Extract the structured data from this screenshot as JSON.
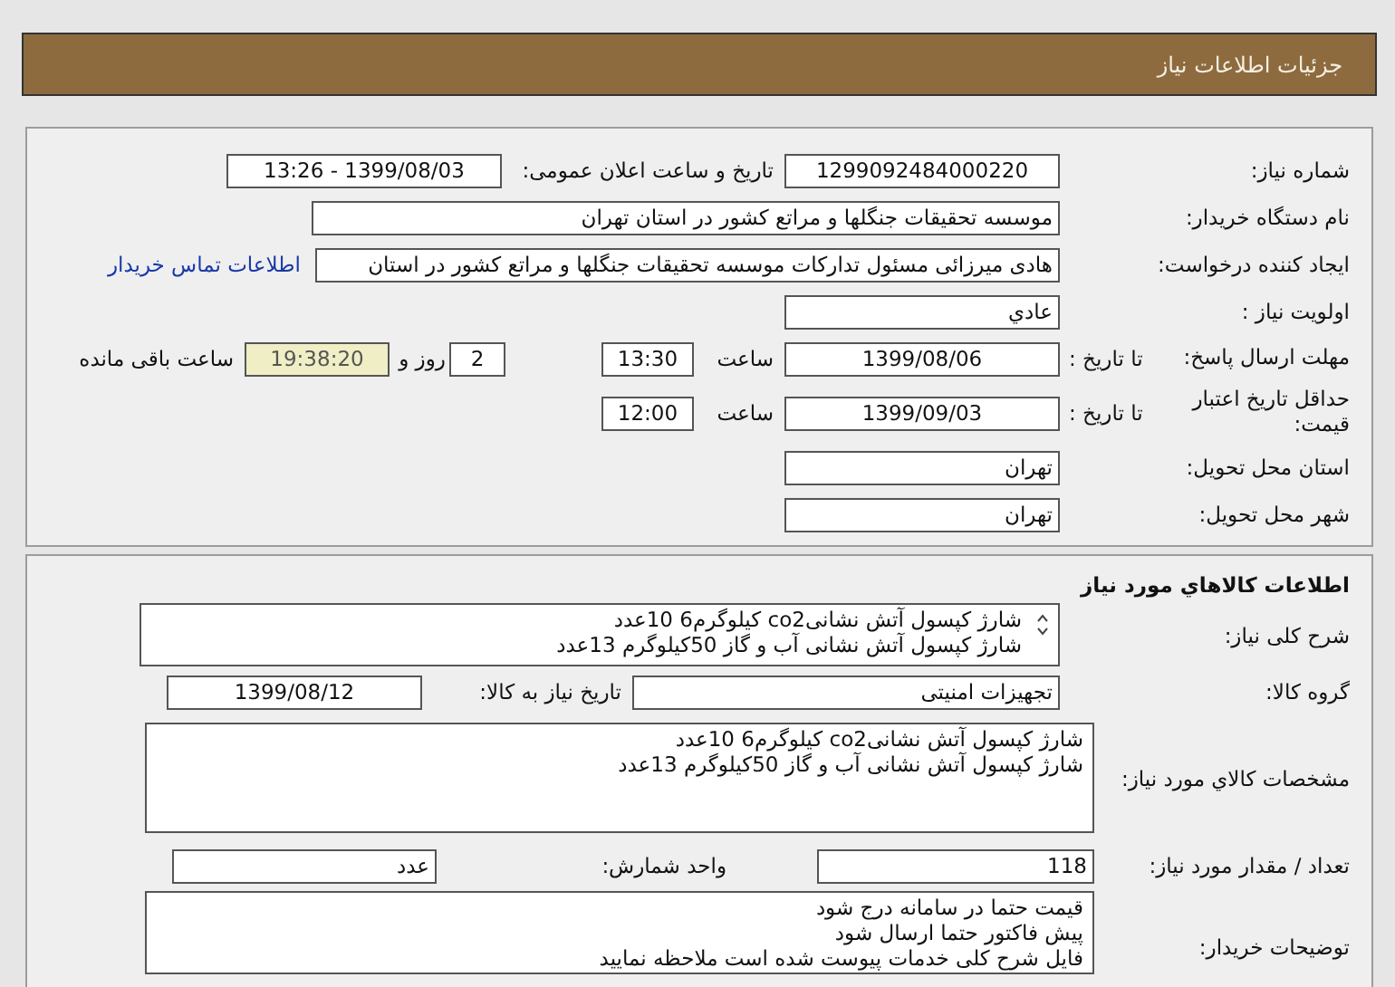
{
  "title": "جزئیات اطلاعات نیاز",
  "need": {
    "need_number": {
      "label": "شماره نیاز:",
      "value": "1299092484000220"
    },
    "announce": {
      "label": "تاریخ و ساعت اعلان عمومی:",
      "value": "1399/08/03 - 13:26"
    },
    "buyer_org": {
      "label": "نام دستگاه خریدار:",
      "value": "موسسه تحقیقات جنگلها و مراتع کشور در استان تهران"
    },
    "requester": {
      "label": "ایجاد کننده درخواست:",
      "value": "هادی میرزائی مسئول تدارکات موسسه تحقیقات جنگلها و مراتع کشور در استان",
      "link": "اطلاعات تماس خریدار"
    },
    "priority": {
      "label": "اولویت نیاز :",
      "value": "عادي"
    },
    "response_deadline": {
      "label": "مهلت ارسال پاسخ:",
      "to_date_label": "تا تاریخ :",
      "date": "1399/08/06",
      "time_label": "ساعت",
      "time": "13:30",
      "days": "2",
      "days_label": "روز و",
      "remaining": "19:38:20",
      "remaining_label": "ساعت باقی مانده"
    },
    "price_validity": {
      "label": "حداقل تاریخ اعتبار قیمت:",
      "to_date_label": "تا تاریخ :",
      "date": "1399/09/03",
      "time_label": "ساعت",
      "time": "12:00"
    },
    "delivery_province": {
      "label": "استان محل تحویل:",
      "value": "تهران"
    },
    "delivery_city": {
      "label": "شهر محل تحویل:",
      "value": "تهران"
    }
  },
  "goods": {
    "heading": "اطلاعات کالاهاي مورد نياز",
    "general_description": {
      "label": "شرح کلی نیاز:",
      "lines": [
        "شارژ کپسول آتش نشانیco2 کیلوگرم6 10عدد",
        "شارژ کپسول آتش نشانی آب و گاز 50کیلوگرم 13عدد"
      ]
    },
    "goods_group": {
      "label": "گروه کالا:",
      "value": "تجهیزات امنیتی"
    },
    "need_date": {
      "label": "تاریخ نیاز به کالا:",
      "value": "1399/08/12"
    },
    "specification": {
      "label": "مشخصات کالاي مورد نياز:",
      "lines": [
        "شارژ کپسول آتش نشانیco2 کیلوگرم6 10عدد",
        "شارژ کپسول آتش نشانی آب و گاز 50کیلوگرم 13عدد"
      ]
    },
    "quantity": {
      "label": "تعداد / مقدار مورد نیاز:",
      "value": "118"
    },
    "unit": {
      "label": "واحد شمارش:",
      "value": "عدد"
    },
    "buyer_notes": {
      "label": "توضیحات خریدار:",
      "lines": [
        "قیمت حتما در سامانه درج شود",
        "پیش فاکتور حتما ارسال شود",
        "فایل شرح کلی خدمات پیوست شده است ملاحظه نمایید"
      ]
    }
  }
}
